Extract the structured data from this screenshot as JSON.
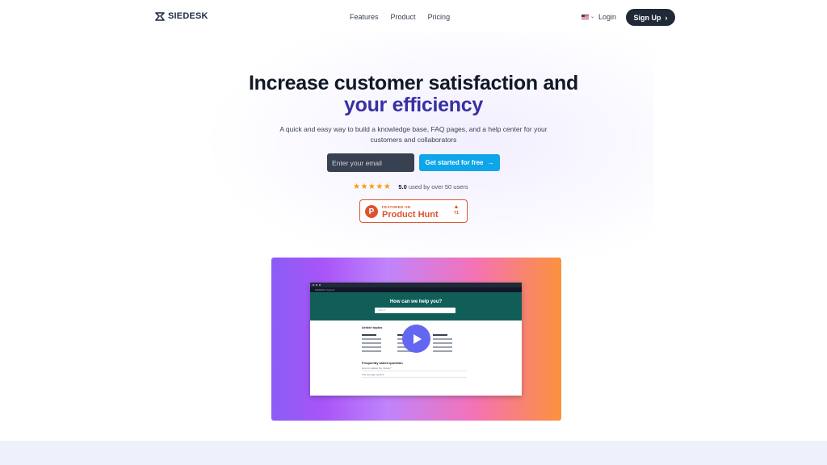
{
  "brand": {
    "name": "SIEDESK"
  },
  "nav": {
    "links": [
      "Features",
      "Product",
      "Pricing"
    ],
    "login": "Login",
    "signup": "Sign Up",
    "signup_arrow": "›"
  },
  "hero": {
    "headline_line1": "Increase customer satisfaction and",
    "headline_line2": "your efficiency",
    "subtitle": "A quick and easy way to build a knowledge base, FAQ pages, and a help center for your customers and collaborators",
    "email_placeholder": "Enter your email",
    "cta_label": "Get started for free",
    "cta_arrow": "→",
    "stars": "★★★★★",
    "rating_score": "5.0",
    "rating_text": "used by over 50 users"
  },
  "product_hunt": {
    "small": "FEATURED ON",
    "big": "Product Hunt",
    "logo_letter": "P",
    "upvote_icon": "▲",
    "count": "71"
  },
  "mock": {
    "tab": "SIEDESK  Support",
    "heading": "How can we help you?",
    "search_placeholder": "Search",
    "section_topics": "Article topics",
    "section_faq": "Frequently asked question",
    "faq_rows": [
      "How to replace the minute?",
      "The average options"
    ]
  },
  "colors": {
    "accent": "#3730a3",
    "cta": "#0ea5e9",
    "product_hunt": "#da552f",
    "play": "#6366f1"
  }
}
